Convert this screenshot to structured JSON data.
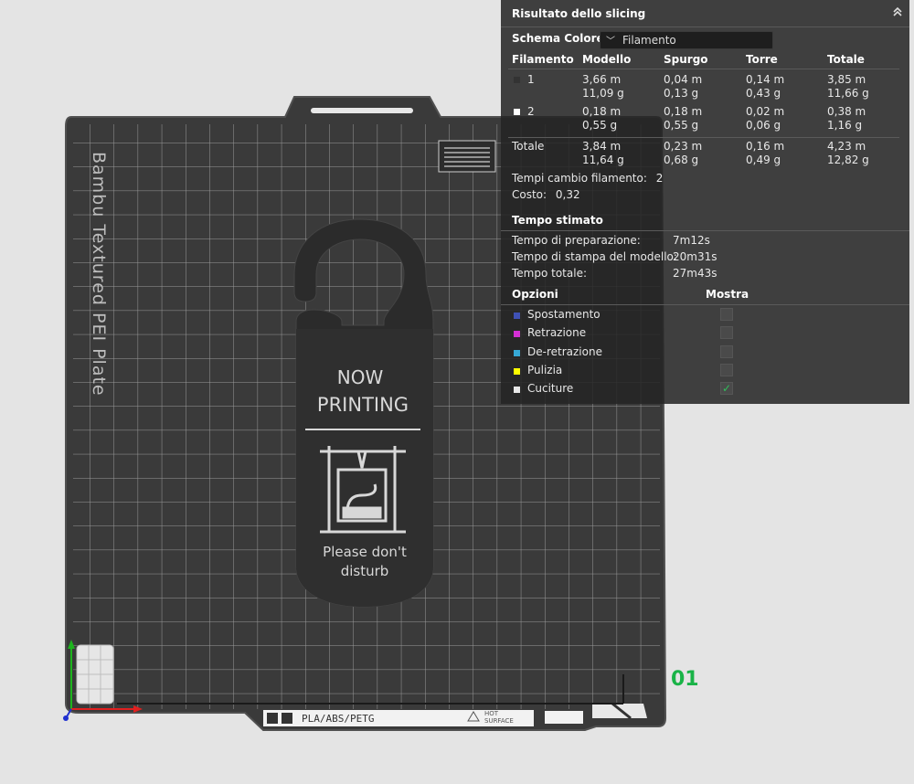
{
  "viewport": {
    "plate_name": "Bambu Textured PEI Plate",
    "plate_number": "01",
    "hanger": {
      "line1": "NOW",
      "line2": "PRINTING",
      "line3": "Please don't",
      "line4": "disturb"
    },
    "bottom_labels": {
      "material": "PLA/ABS/PETG",
      "hot1": "HOT",
      "hot2": "SURFACE"
    }
  },
  "panel": {
    "title": "Risultato dello slicing",
    "collapse_icon": "chevron-up-double-icon",
    "color_scheme_label": "Schema Colore",
    "color_scheme_value": "Filamento",
    "columns": [
      "Filamento",
      "Modello",
      "Spurgo",
      "Torre",
      "Totale"
    ],
    "rows": [
      {
        "id": "1",
        "color": "#333333",
        "modello": [
          "3,66 m",
          "11,09 g"
        ],
        "spurgo": [
          "0,04 m",
          "0,13 g"
        ],
        "torre": [
          "0,14 m",
          "0,43 g"
        ],
        "totale": [
          "3,85 m",
          "11,66 g"
        ]
      },
      {
        "id": "2",
        "color": "#ffffff",
        "modello": [
          "0,18 m",
          "0,55 g"
        ],
        "spurgo": [
          "0,18 m",
          "0,55 g"
        ],
        "torre": [
          "0,02 m",
          "0,06 g"
        ],
        "totale": [
          "0,38 m",
          "1,16 g"
        ]
      }
    ],
    "total": {
      "label": "Totale",
      "modello": [
        "3,84 m",
        "11,64 g"
      ],
      "spurgo": [
        "0,23 m",
        "0,68 g"
      ],
      "torre": [
        "0,16 m",
        "0,49 g"
      ],
      "totale": [
        "4,23 m",
        "12,82 g"
      ]
    },
    "filament_changes_label": "Tempi cambio filamento:",
    "filament_changes_value": "2",
    "cost_label": "Costo:",
    "cost_value": "0,32",
    "time_section_title": "Tempo stimato",
    "times": [
      {
        "label": "Tempo di preparazione:",
        "value": "7m12s"
      },
      {
        "label": "Tempo di stampa del modello:",
        "value": "20m31s"
      },
      {
        "label": "Tempo totale:",
        "value": "27m43s"
      }
    ],
    "options_title": "Opzioni",
    "show_title": "Mostra",
    "options": [
      {
        "label": "Spostamento",
        "color": "#3f51b5",
        "checked": false
      },
      {
        "label": "Retrazione",
        "color": "#d42fd4",
        "checked": false
      },
      {
        "label": "De-retrazione",
        "color": "#36a9d6",
        "checked": false
      },
      {
        "label": "Pulizia",
        "color": "#ffff00",
        "checked": false
      },
      {
        "label": "Cuciture",
        "color": "#e8e8e8",
        "checked": true
      }
    ],
    "check_glyph": "✓"
  }
}
